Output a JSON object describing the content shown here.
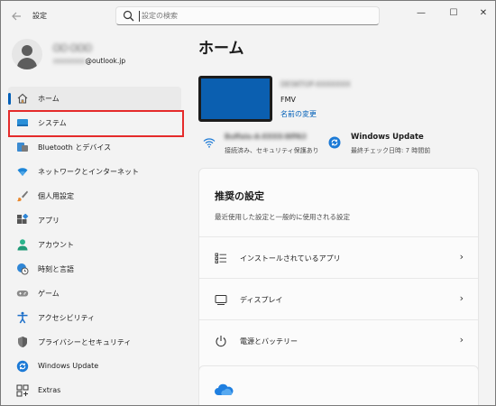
{
  "window": {
    "app_title": "設定",
    "search_placeholder": "設定の検索",
    "controls": {
      "minimize": "—",
      "maximize": "☐",
      "close": "✕"
    }
  },
  "profile": {
    "name": "〇〇 〇〇〇",
    "email_prefix": "xxxxxxxx",
    "email_domain": "@outlook.jp"
  },
  "sidebar": {
    "items": [
      {
        "label": "ホーム",
        "icon": "home-icon",
        "active": true
      },
      {
        "label": "システム",
        "icon": "display-icon",
        "active": false
      },
      {
        "label": "Bluetooth とデバイス",
        "icon": "bluetooth-icon",
        "active": false
      },
      {
        "label": "ネットワークとインターネット",
        "icon": "wifi-icon",
        "active": false
      },
      {
        "label": "個人用設定",
        "icon": "brush-icon",
        "active": false
      },
      {
        "label": "アプリ",
        "icon": "apps-icon",
        "active": false
      },
      {
        "label": "アカウント",
        "icon": "person-icon",
        "active": false
      },
      {
        "label": "時刻と言語",
        "icon": "clock-globe-icon",
        "active": false
      },
      {
        "label": "ゲーム",
        "icon": "gamepad-icon",
        "active": false
      },
      {
        "label": "アクセシビリティ",
        "icon": "accessibility-icon",
        "active": false
      },
      {
        "label": "プライバシーとセキュリティ",
        "icon": "shield-icon",
        "active": false
      },
      {
        "label": "Windows Update",
        "icon": "update-icon",
        "active": false
      },
      {
        "label": "Extras",
        "icon": "extras-icon",
        "active": false
      }
    ]
  },
  "main": {
    "title": "ホーム",
    "device": {
      "name": "DESKTOP-XXXXXXX",
      "model": "FMV",
      "rename_link": "名前の変更"
    },
    "network": {
      "name": "Buffalo-A-XXXX-WPA3",
      "status": "接続済み、セキュリティ保護あり"
    },
    "windows_update": {
      "title": "Windows Update",
      "status": "最終チェック日時: 7 時間前"
    },
    "recommended": {
      "title": "推奨の設定",
      "description": "最近使用した設定と一般的に使用される設定",
      "rows": [
        {
          "label": "インストールされているアプリ",
          "icon": "list-icon"
        },
        {
          "label": "ディスプレイ",
          "icon": "monitor-icon"
        },
        {
          "label": "電源とバッテリー",
          "icon": "power-icon"
        }
      ],
      "chevron": "›"
    }
  },
  "colors": {
    "accent": "#005fb8",
    "highlight_box": "#e52b2b",
    "device_thumb": "#0b5fb0"
  }
}
